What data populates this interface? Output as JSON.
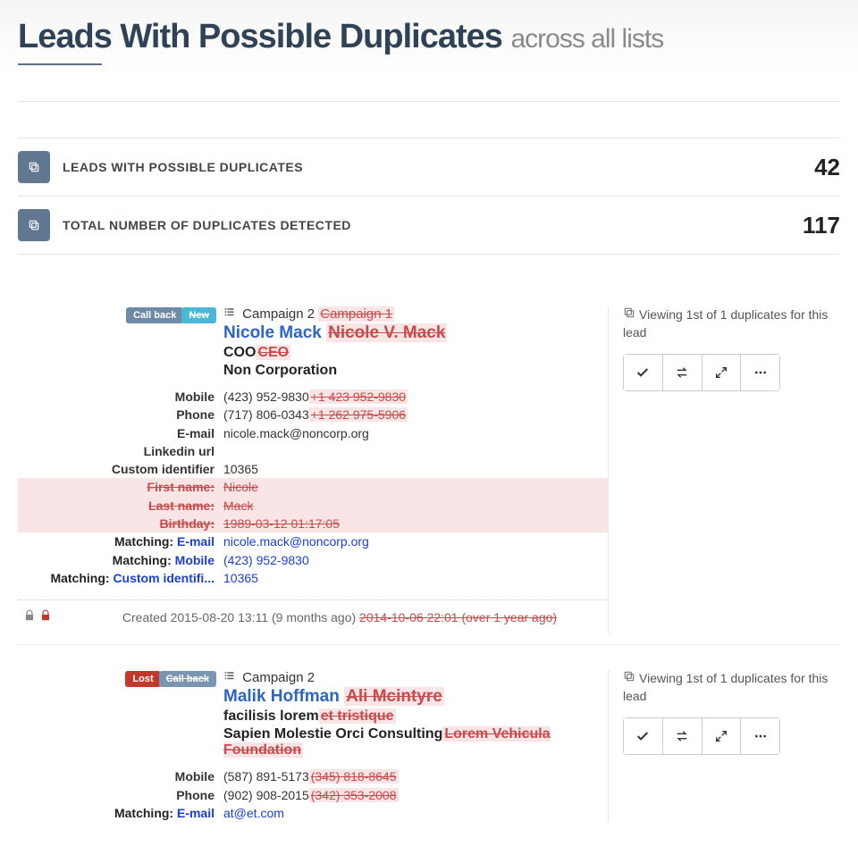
{
  "header": {
    "title": "Leads With Possible Duplicates",
    "subtitle": "across all lists"
  },
  "stats": [
    {
      "label": "LEADS WITH POSSIBLE DUPLICATES",
      "value": "42"
    },
    {
      "label": "TOTAL NUMBER OF DUPLICATES DETECTED",
      "value": "117"
    }
  ],
  "leads": [
    {
      "badges": [
        {
          "text": "Call back",
          "style": "callback"
        },
        {
          "text": "New",
          "style": "new"
        }
      ],
      "campaign": {
        "current": "Campaign 2",
        "old": "Campaign 1"
      },
      "name": {
        "current": "Nicole Mack",
        "old": "Nicole V. Mack"
      },
      "job": {
        "current": "COO",
        "old": "CEO"
      },
      "company": {
        "current": "Non Corporation",
        "old": ""
      },
      "fields": [
        {
          "label": "Mobile",
          "value": "(423) 952-9830",
          "old": "+1 423 952-9830"
        },
        {
          "label": "Phone",
          "value": "(717) 806-0343",
          "old": "+1 262 975-5906"
        },
        {
          "label": "E-mail",
          "value": "nicole.mack@noncorp.org",
          "old": ""
        },
        {
          "label": "Linkedin url",
          "value": "",
          "old": ""
        },
        {
          "label": "Custom identifier",
          "value": "10365",
          "old": ""
        }
      ],
      "removed_fields": [
        {
          "label": "First name:",
          "value": "Nicole"
        },
        {
          "label": "Last name:",
          "value": "Mack"
        },
        {
          "label": "Birthday:",
          "value": "1989-03-12 01:17:05"
        }
      ],
      "matching": [
        {
          "key": "E-mail",
          "value": "nicole.mack@noncorp.org"
        },
        {
          "key": "Mobile",
          "value": "(423) 952-9830"
        },
        {
          "key": "Custom identifi...",
          "value": "10365"
        }
      ],
      "created": {
        "current": "Created 2015-08-20 13:11 (9 months ago)",
        "old": "2014-10-06 22:01 (over 1 year ago)"
      },
      "sidebar": {
        "viewing": "Viewing 1st of 1 duplicates for this lead"
      }
    },
    {
      "badges": [
        {
          "text": "Lost",
          "style": "lost"
        },
        {
          "text": "Call back",
          "style": "callback-strike"
        }
      ],
      "campaign": {
        "current": "Campaign 2",
        "old": ""
      },
      "name": {
        "current": "Malik Hoffman",
        "old": "Ali Mcintyre"
      },
      "job": {
        "current": "facilisis lorem",
        "old": "et tristique"
      },
      "company": {
        "current": "Sapien Molestie Orci Consulting",
        "old": "Lorem Vehicula Foundation"
      },
      "fields": [
        {
          "label": "Mobile",
          "value": "(587) 891-5173",
          "old": "(345) 818-8645"
        },
        {
          "label": "Phone",
          "value": "(902) 908-2015",
          "old": "(342) 353-2008"
        }
      ],
      "removed_fields": [],
      "matching": [
        {
          "key": "E-mail",
          "value": "at@et.com"
        }
      ],
      "created": null,
      "sidebar": {
        "viewing": "Viewing 1st of 1 duplicates for this lead"
      }
    }
  ],
  "labels": {
    "matching_prefix": "Matching:"
  }
}
